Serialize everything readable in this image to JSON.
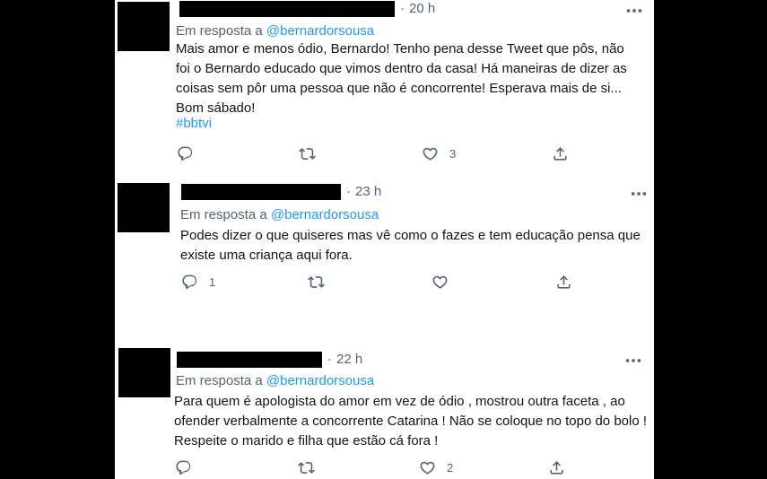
{
  "tweets": [
    {
      "time": "20 h",
      "reply_prefix": "Em resposta a",
      "reply_handle": "@bernardorsousa",
      "text": "Mais amor e menos ódio, Bernardo! Tenho pena desse Tweet que pôs, não foi o Bernardo educado que vimos dentro da casa! Há maneiras de dizer as coisas sem pôr uma pessoa que não é concorrente! Esperava mais de si... Bom sábado!",
      "hashtag": "#bbtvi",
      "reply_count": "",
      "retweet_count": "",
      "like_count": "3"
    },
    {
      "time": "23 h",
      "reply_prefix": "Em resposta a",
      "reply_handle": "@bernardorsousa",
      "text": "Podes dizer o que quiseres mas vê como o fazes e tem educação  pensa que existe uma criança aqui fora.",
      "reply_count": "1",
      "retweet_count": "",
      "like_count": ""
    },
    {
      "time": "22 h",
      "reply_prefix": "Em resposta a",
      "reply_handle": "@bernardorsousa",
      "text": "Para quem é apologista do amor em vez de ódio , mostrou outra faceta , ao ofender verbalmente a concorrente Catarina ! Não se coloque no topo do bolo ! Respeite o marido e filha que estão cá fora !",
      "reply_count": "",
      "retweet_count": "",
      "like_count": "2"
    }
  ],
  "icons": {
    "more": "more-horizontal-icon",
    "reply": "reply-icon",
    "retweet": "retweet-icon",
    "like": "heart-icon",
    "share": "share-icon"
  },
  "colors": {
    "background": "#000000",
    "card": "#ffffff",
    "text": "#0f1419",
    "secondary": "#536471",
    "link": "#1d9bf0"
  }
}
